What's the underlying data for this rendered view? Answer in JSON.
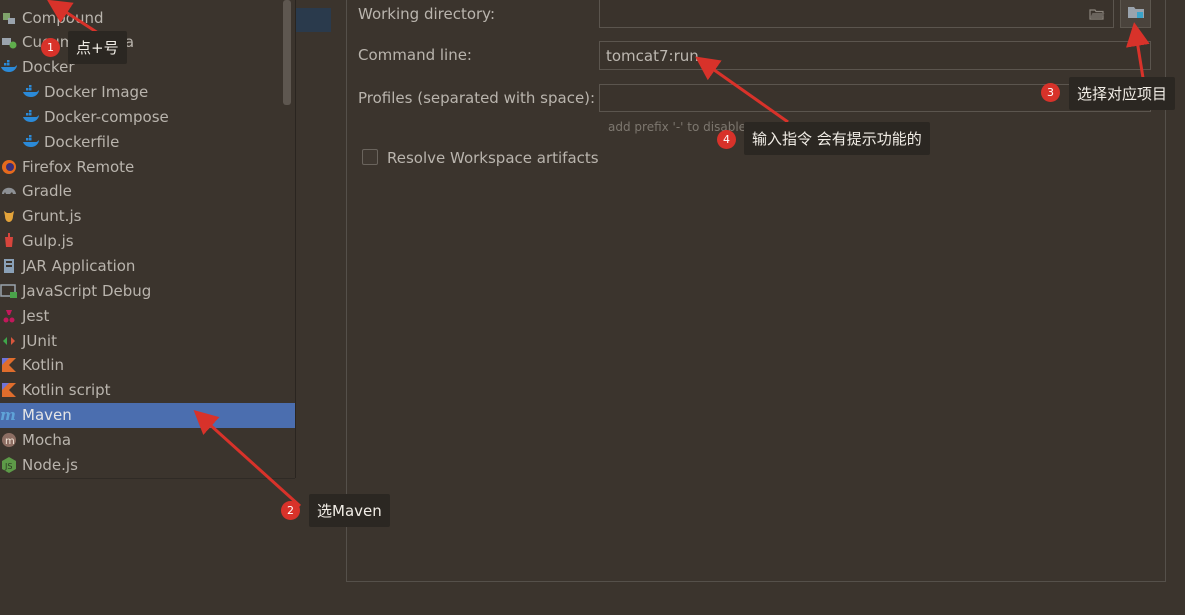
{
  "left_tree": {
    "items": [
      {
        "label": "Compound",
        "icon": "compound-icon",
        "child": false,
        "selected": false
      },
      {
        "label": "Cucumber.java",
        "icon": "cucumber-icon",
        "child": false,
        "selected": false
      },
      {
        "label": "Docker",
        "icon": "docker-icon",
        "child": false,
        "selected": false
      },
      {
        "label": "Docker Image",
        "icon": "docker-icon",
        "child": true,
        "selected": false
      },
      {
        "label": "Docker-compose",
        "icon": "docker-icon",
        "child": true,
        "selected": false
      },
      {
        "label": "Dockerfile",
        "icon": "docker-icon",
        "child": true,
        "selected": false
      },
      {
        "label": "Firefox Remote",
        "icon": "firefox-icon",
        "child": false,
        "selected": false
      },
      {
        "label": "Gradle",
        "icon": "gradle-icon",
        "child": false,
        "selected": false
      },
      {
        "label": "Grunt.js",
        "icon": "grunt-icon",
        "child": false,
        "selected": false
      },
      {
        "label": "Gulp.js",
        "icon": "gulp-icon",
        "child": false,
        "selected": false
      },
      {
        "label": "JAR Application",
        "icon": "jar-icon",
        "child": false,
        "selected": false
      },
      {
        "label": "JavaScript Debug",
        "icon": "js-debug-icon",
        "child": false,
        "selected": false
      },
      {
        "label": "Jest",
        "icon": "jest-icon",
        "child": false,
        "selected": false
      },
      {
        "label": "JUnit",
        "icon": "junit-icon",
        "child": false,
        "selected": false
      },
      {
        "label": "Kotlin",
        "icon": "kotlin-icon",
        "child": false,
        "selected": false
      },
      {
        "label": "Kotlin script",
        "icon": "kotlin-icon",
        "child": false,
        "selected": false
      },
      {
        "label": "Maven",
        "icon": "maven-icon",
        "child": false,
        "selected": true
      },
      {
        "label": "Mocha",
        "icon": "mocha-icon",
        "child": false,
        "selected": false
      },
      {
        "label": "Node.js",
        "icon": "nodejs-icon",
        "child": false,
        "selected": false
      }
    ]
  },
  "form": {
    "working_directory_label": "Working directory:",
    "working_directory_value": "",
    "command_line_label": "Command line:",
    "command_line_value": "tomcat7:run",
    "profiles_label": "Profiles (separated with space):",
    "profiles_value": "",
    "profiles_hint": "add prefix '-' to disable",
    "resolve_label": "Resolve Workspace artifacts"
  },
  "annotations": [
    {
      "number": "1",
      "text": "点+号"
    },
    {
      "number": "2",
      "text": "选Maven"
    },
    {
      "number": "3",
      "text": "选择对应项目"
    },
    {
      "number": "4",
      "text": "输入指令 会有提示功能的"
    }
  ],
  "colors": {
    "background": "#3b342d",
    "selection": "#4b6eaf",
    "callout_bg": "#2b2722",
    "badge": "#d8322a",
    "arrow": "#d8322a"
  }
}
